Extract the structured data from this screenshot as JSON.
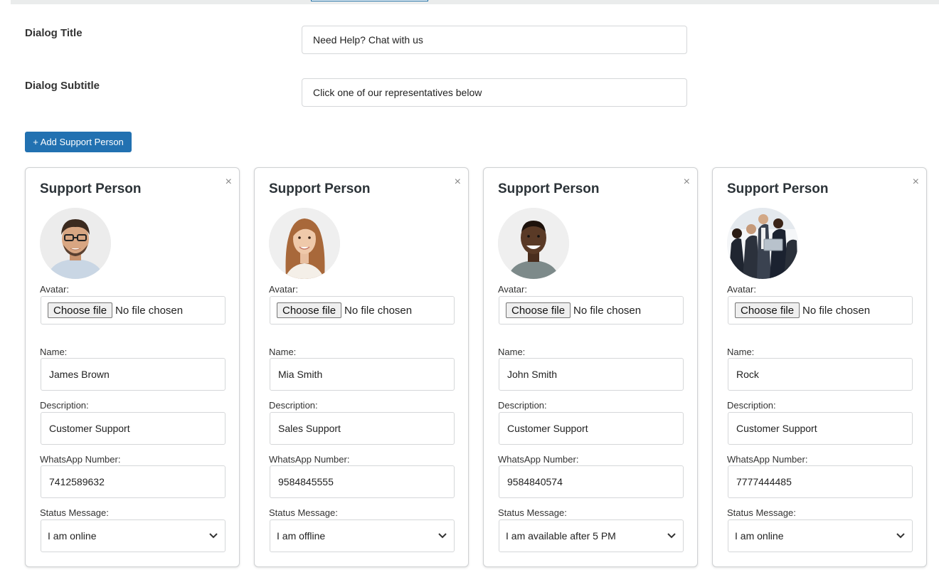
{
  "dialog_title": {
    "label": "Dialog Title",
    "value": "Need Help? Chat with us"
  },
  "dialog_subtitle": {
    "label": "Dialog Subtitle",
    "value": "Click one of our representatives below"
  },
  "add_button_label": "+ Add Support Person",
  "accent_color": "#2271b1",
  "card_labels": {
    "title": "Support Person",
    "close": "×",
    "avatar": "Avatar:",
    "choose_file": "Choose file",
    "no_file": "No file chosen",
    "name": "Name:",
    "description": "Description:",
    "whatsapp": "WhatsApp Number:",
    "status": "Status Message:"
  },
  "persons": [
    {
      "name": "James Brown",
      "description": "Customer Support",
      "whatsapp": "7412589632",
      "status": "I am online",
      "avatar_icon": "man-glasses-portrait"
    },
    {
      "name": "Mia Smith",
      "description": "Sales Support",
      "whatsapp": "9584845555",
      "status": "I am offline",
      "avatar_icon": "woman-portrait"
    },
    {
      "name": "John Smith",
      "description": "Customer Support",
      "whatsapp": "9584840574",
      "status": "I am available after 5 PM",
      "avatar_icon": "man-smiling-portrait"
    },
    {
      "name": "Rock",
      "description": "Customer Support",
      "whatsapp": "7777444485",
      "status": "I am online",
      "avatar_icon": "business-group-photo"
    }
  ]
}
